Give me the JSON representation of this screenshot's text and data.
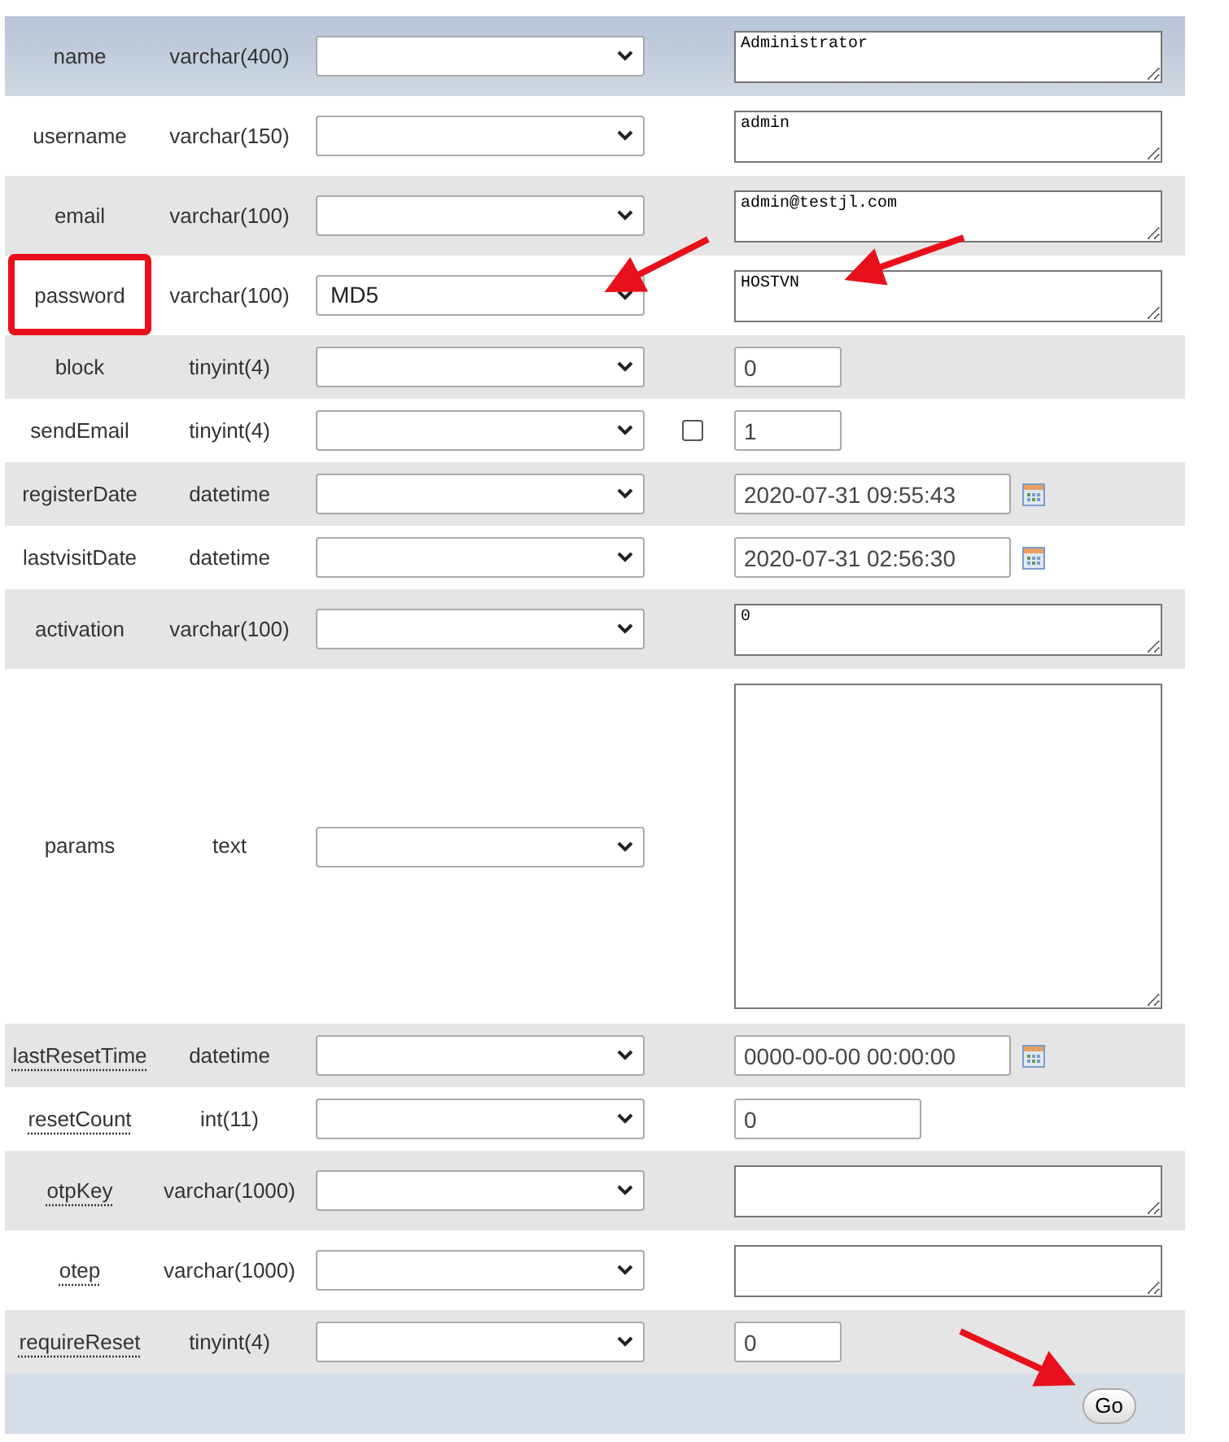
{
  "rows": [
    {
      "column": "name",
      "type": "varchar(400)",
      "function": "",
      "kind": "textarea",
      "value": "Administrator",
      "commented": false,
      "highlighted": true
    },
    {
      "column": "username",
      "type": "varchar(150)",
      "function": "",
      "kind": "textarea",
      "value": "admin",
      "commented": false,
      "highlighted": false
    },
    {
      "column": "email",
      "type": "varchar(100)",
      "function": "",
      "kind": "textarea",
      "value": "admin@testjl.com",
      "commented": false,
      "highlighted": false
    },
    {
      "column": "password",
      "type": "varchar(100)",
      "function": "MD5",
      "kind": "textarea",
      "value": "HOSTVN",
      "commented": false,
      "highlighted": false
    },
    {
      "column": "block",
      "type": "tinyint(4)",
      "function": "",
      "kind": "short",
      "value": "0",
      "commented": false,
      "highlighted": false
    },
    {
      "column": "sendEmail",
      "type": "tinyint(4)",
      "function": "",
      "kind": "short",
      "value": "1",
      "commented": false,
      "highlighted": false,
      "null_box": {
        "checked": false
      }
    },
    {
      "column": "registerDate",
      "type": "datetime",
      "function": "",
      "kind": "datetime",
      "value": "2020-07-31 09:55:43",
      "commented": false,
      "highlighted": false
    },
    {
      "column": "lastvisitDate",
      "type": "datetime",
      "function": "",
      "kind": "datetime",
      "value": "2020-07-31 02:56:30",
      "commented": false,
      "highlighted": false
    },
    {
      "column": "activation",
      "type": "varchar(100)",
      "function": "",
      "kind": "textarea",
      "value": "0",
      "commented": false,
      "highlighted": false
    },
    {
      "column": "params",
      "type": "text",
      "function": "",
      "kind": "large",
      "value": "",
      "commented": false,
      "highlighted": false
    },
    {
      "column": "lastResetTime",
      "type": "datetime",
      "function": "",
      "kind": "datetime",
      "value": "0000-00-00 00:00:00",
      "commented": true,
      "highlighted": false
    },
    {
      "column": "resetCount",
      "type": "int(11)",
      "function": "",
      "kind": "medium",
      "value": "0",
      "commented": true,
      "highlighted": false
    },
    {
      "column": "otpKey",
      "type": "varchar(1000)",
      "function": "",
      "kind": "textarea",
      "value": "",
      "commented": true,
      "highlighted": false
    },
    {
      "column": "otep",
      "type": "varchar(1000)",
      "function": "",
      "kind": "textarea",
      "value": "",
      "commented": true,
      "highlighted": false
    },
    {
      "column": "requireReset",
      "type": "tinyint(4)",
      "function": "",
      "kind": "short",
      "value": "0",
      "commented": true,
      "highlighted": false
    }
  ],
  "go_button": "Go"
}
